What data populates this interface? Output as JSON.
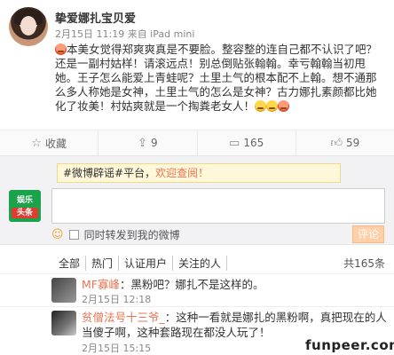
{
  "post": {
    "username": "挚爱娜扎宝贝爱",
    "meta": "2月15日 11:19 来自 iPad mini",
    "text_parts": [
      "本美女觉得郑爽爽真是不要脸。整容整的连自己都不认识了吧？还是一副村姑样！请滚远点！别总倒贴张翰翰。幸亏翰翰当初甩她。王子怎么能爱上青蛙呢？土里土气的根本配不上翰。想不通那么多人称她是女神，土里土气的怎么是女神？古力娜扎素颜都比她化了妆美！村姑爽就是一个掏粪老女人！"
    ]
  },
  "actions": {
    "favorite": "收藏",
    "repost": "9",
    "comment": "165",
    "like": "59"
  },
  "commentbox": {
    "notice_prefix": "#微博辟谣#平台，",
    "notice_link": "欢迎查阅！",
    "brand_top": "娱乐",
    "brand_bottom": "头条",
    "also_repost": "同时转发到我的微博",
    "submit": "评论"
  },
  "filters": {
    "items": [
      "全部",
      "热门",
      "认证用户",
      "关注的人"
    ],
    "total": "共165条"
  },
  "comments": [
    {
      "name": "MF寡峰",
      "text": "：黑粉吧？娜扎不是这样的。",
      "time": "2月15日 12:18"
    },
    {
      "name": "贫僧法号十三爷_",
      "text": "：这种一看就是娜扎的黑粉啊，真把现在的人当傻子啊，这种套路现在都没人玩了！",
      "time": "2月15日 15:15"
    }
  ],
  "watermark": "funpeer.com"
}
